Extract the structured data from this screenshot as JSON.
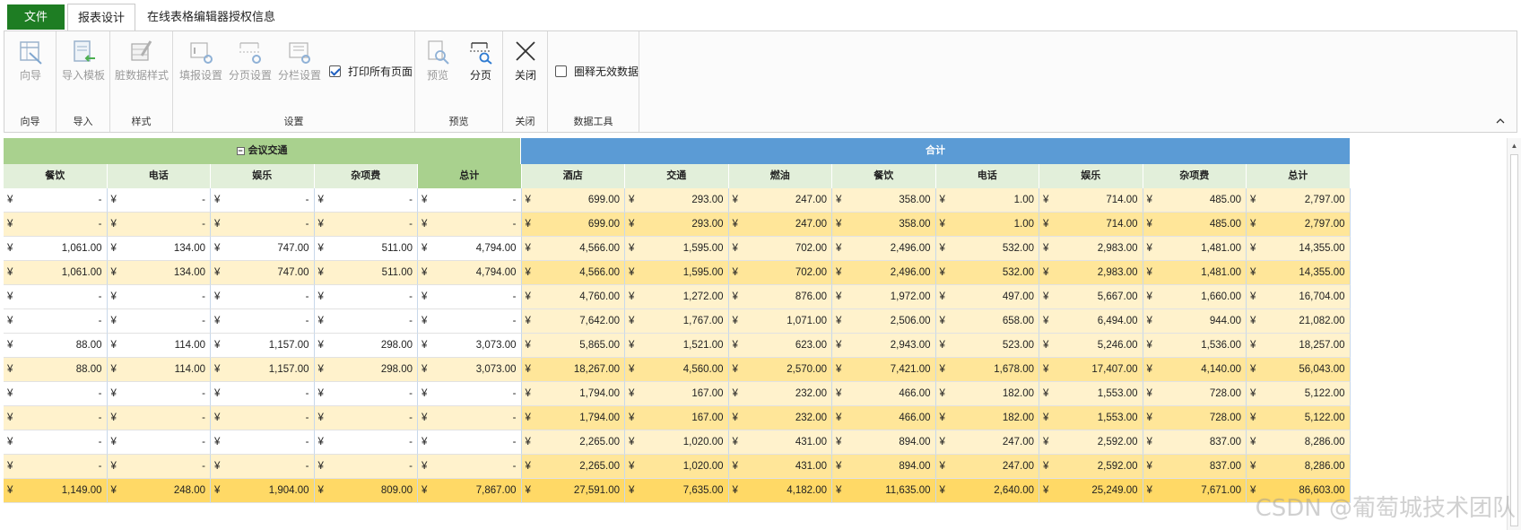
{
  "tabs": {
    "file": "文件",
    "design": "报表设计",
    "license": "在线表格编辑器授权信息"
  },
  "ribbon": {
    "groups": {
      "guide": "向导",
      "import": "导入",
      "style": "样式",
      "settings": "设置",
      "preview": "预览",
      "close": "关闭",
      "tools": "数据工具"
    },
    "buttons": {
      "guide": "向导",
      "import_template": "导入模板",
      "dirty_style": "脏数据样式",
      "fill_settings": "填报设置",
      "page_settings": "分页设置",
      "column_settings": "分栏设置",
      "preview": "预览",
      "paging": "分页",
      "close": "关闭"
    },
    "print_all_label": "打印所有页面",
    "print_all_checked": true,
    "circle_invalid_label": "圈释无效数据",
    "circle_invalid_checked": false
  },
  "grid": {
    "group_left": "会议交通",
    "group_right": "合计",
    "headers_left": [
      "餐饮",
      "电话",
      "娱乐",
      "杂项费",
      "总计"
    ],
    "headers_right": [
      "酒店",
      "交通",
      "燃油",
      "餐饮",
      "电话",
      "娱乐",
      "杂项费",
      "总计"
    ],
    "currency": "¥",
    "colors": {
      "group_left_bg": "#a9d18e",
      "group_right_bg": "#5b9bd5",
      "header_bg": "#e2efda",
      "header_total_bg": "#a9d18e",
      "row_white": "#ffffff",
      "row_cream": "#fff2cc",
      "row_gold": "#ffe699",
      "row_total": "#ffd966"
    },
    "rows": [
      {
        "style": "white",
        "left": [
          "-",
          "-",
          "-",
          "-",
          "-"
        ],
        "right": [
          "699.00",
          "293.00",
          "247.00",
          "358.00",
          "1.00",
          "714.00",
          "485.00",
          "2,797.00"
        ]
      },
      {
        "style": "cream",
        "left": [
          "-",
          "-",
          "-",
          "-",
          "-"
        ],
        "right": [
          "699.00",
          "293.00",
          "247.00",
          "358.00",
          "1.00",
          "714.00",
          "485.00",
          "2,797.00"
        ]
      },
      {
        "style": "white",
        "left": [
          "1,061.00",
          "134.00",
          "747.00",
          "511.00",
          "4,794.00"
        ],
        "right": [
          "4,566.00",
          "1,595.00",
          "702.00",
          "2,496.00",
          "532.00",
          "2,983.00",
          "1,481.00",
          "14,355.00"
        ]
      },
      {
        "style": "cream",
        "left": [
          "1,061.00",
          "134.00",
          "747.00",
          "511.00",
          "4,794.00"
        ],
        "right": [
          "4,566.00",
          "1,595.00",
          "702.00",
          "2,496.00",
          "532.00",
          "2,983.00",
          "1,481.00",
          "14,355.00"
        ]
      },
      {
        "style": "white",
        "left": [
          "-",
          "-",
          "-",
          "-",
          "-"
        ],
        "right": [
          "4,760.00",
          "1,272.00",
          "876.00",
          "1,972.00",
          "497.00",
          "5,667.00",
          "1,660.00",
          "16,704.00"
        ]
      },
      {
        "style": "white",
        "left": [
          "-",
          "-",
          "-",
          "-",
          "-"
        ],
        "right": [
          "7,642.00",
          "1,767.00",
          "1,071.00",
          "2,506.00",
          "658.00",
          "6,494.00",
          "944.00",
          "21,082.00"
        ]
      },
      {
        "style": "white",
        "left": [
          "88.00",
          "114.00",
          "1,157.00",
          "298.00",
          "3,073.00"
        ],
        "right": [
          "5,865.00",
          "1,521.00",
          "623.00",
          "2,943.00",
          "523.00",
          "5,246.00",
          "1,536.00",
          "18,257.00"
        ]
      },
      {
        "style": "cream",
        "left": [
          "88.00",
          "114.00",
          "1,157.00",
          "298.00",
          "3,073.00"
        ],
        "right": [
          "18,267.00",
          "4,560.00",
          "2,570.00",
          "7,421.00",
          "1,678.00",
          "17,407.00",
          "4,140.00",
          "56,043.00"
        ]
      },
      {
        "style": "white",
        "left": [
          "-",
          "-",
          "-",
          "-",
          "-"
        ],
        "right": [
          "1,794.00",
          "167.00",
          "232.00",
          "466.00",
          "182.00",
          "1,553.00",
          "728.00",
          "5,122.00"
        ]
      },
      {
        "style": "cream",
        "left": [
          "-",
          "-",
          "-",
          "-",
          "-"
        ],
        "right": [
          "1,794.00",
          "167.00",
          "232.00",
          "466.00",
          "182.00",
          "1,553.00",
          "728.00",
          "5,122.00"
        ]
      },
      {
        "style": "white",
        "left": [
          "-",
          "-",
          "-",
          "-",
          "-"
        ],
        "right": [
          "2,265.00",
          "1,020.00",
          "431.00",
          "894.00",
          "247.00",
          "2,592.00",
          "837.00",
          "8,286.00"
        ]
      },
      {
        "style": "cream",
        "left": [
          "-",
          "-",
          "-",
          "-",
          "-"
        ],
        "right": [
          "2,265.00",
          "1,020.00",
          "431.00",
          "894.00",
          "247.00",
          "2,592.00",
          "837.00",
          "8,286.00"
        ]
      },
      {
        "style": "total",
        "left": [
          "1,149.00",
          "248.00",
          "1,904.00",
          "809.00",
          "7,867.00"
        ],
        "right": [
          "27,591.00",
          "7,635.00",
          "4,182.00",
          "11,635.00",
          "2,640.00",
          "25,249.00",
          "7,671.00",
          "86,603.00"
        ]
      }
    ]
  },
  "watermark": "CSDN @葡萄城技术团队"
}
